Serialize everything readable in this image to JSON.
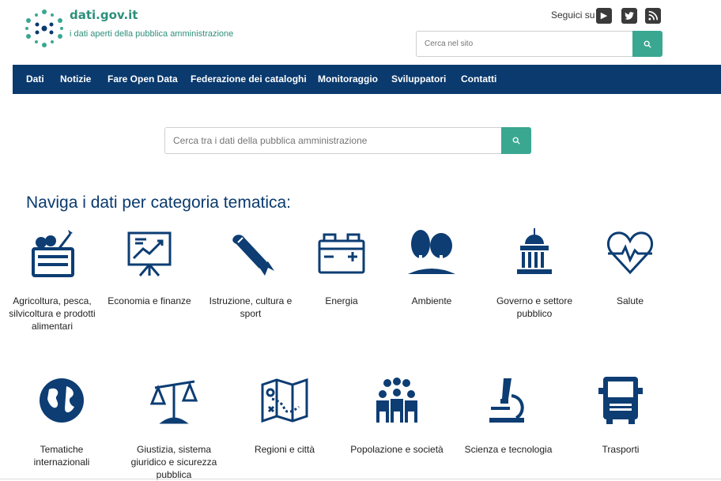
{
  "header": {
    "site_name": "dati.gov.it",
    "tagline": "i dati aperti della pubblica amministrazione",
    "follow_label": "Seguici su",
    "social": [
      "youtube-icon",
      "twitter-icon",
      "rss-icon"
    ],
    "site_search_placeholder": "Cerca nel sito"
  },
  "nav": {
    "items": [
      "Dati",
      "Notizie",
      "Fare Open Data",
      "Federazione dei cataloghi",
      "Monitoraggio",
      "Sviluppatori",
      "Contatti"
    ]
  },
  "main": {
    "search_placeholder": "Cerca tra i dati della pubblica amministrazione",
    "section_title": "Naviga i dati per categoria tematica:",
    "categories": [
      {
        "label": "Agricoltura, pesca, silvicoltura e prodotti alimentari",
        "icon": "crate-vegetables-icon"
      },
      {
        "label": "Economia e finanze",
        "icon": "chart-board-icon"
      },
      {
        "label": "Istruzione, cultura e sport",
        "icon": "diploma-icon"
      },
      {
        "label": "Energia",
        "icon": "battery-icon"
      },
      {
        "label": "Ambiente",
        "icon": "trees-icon"
      },
      {
        "label": "Governo e settore pubblico",
        "icon": "capitol-icon"
      },
      {
        "label": "Salute",
        "icon": "heartbeat-icon"
      },
      {
        "label": "Tematiche internazionali",
        "icon": "globe-icon"
      },
      {
        "label": "Giustizia, sistema giuridico e sicurezza pubblica",
        "icon": "scales-icon"
      },
      {
        "label": "Regioni e città",
        "icon": "map-icon"
      },
      {
        "label": "Popolazione e società",
        "icon": "people-icon"
      },
      {
        "label": "Scienza e tecnologia",
        "icon": "microscope-icon"
      },
      {
        "label": "Trasporti",
        "icon": "truck-icon"
      }
    ]
  },
  "colors": {
    "brand_green": "#2d8f7b",
    "accent_teal": "#3aa791",
    "nav_blue": "#0a3a6e",
    "icon_blue": "#0d3d73"
  }
}
